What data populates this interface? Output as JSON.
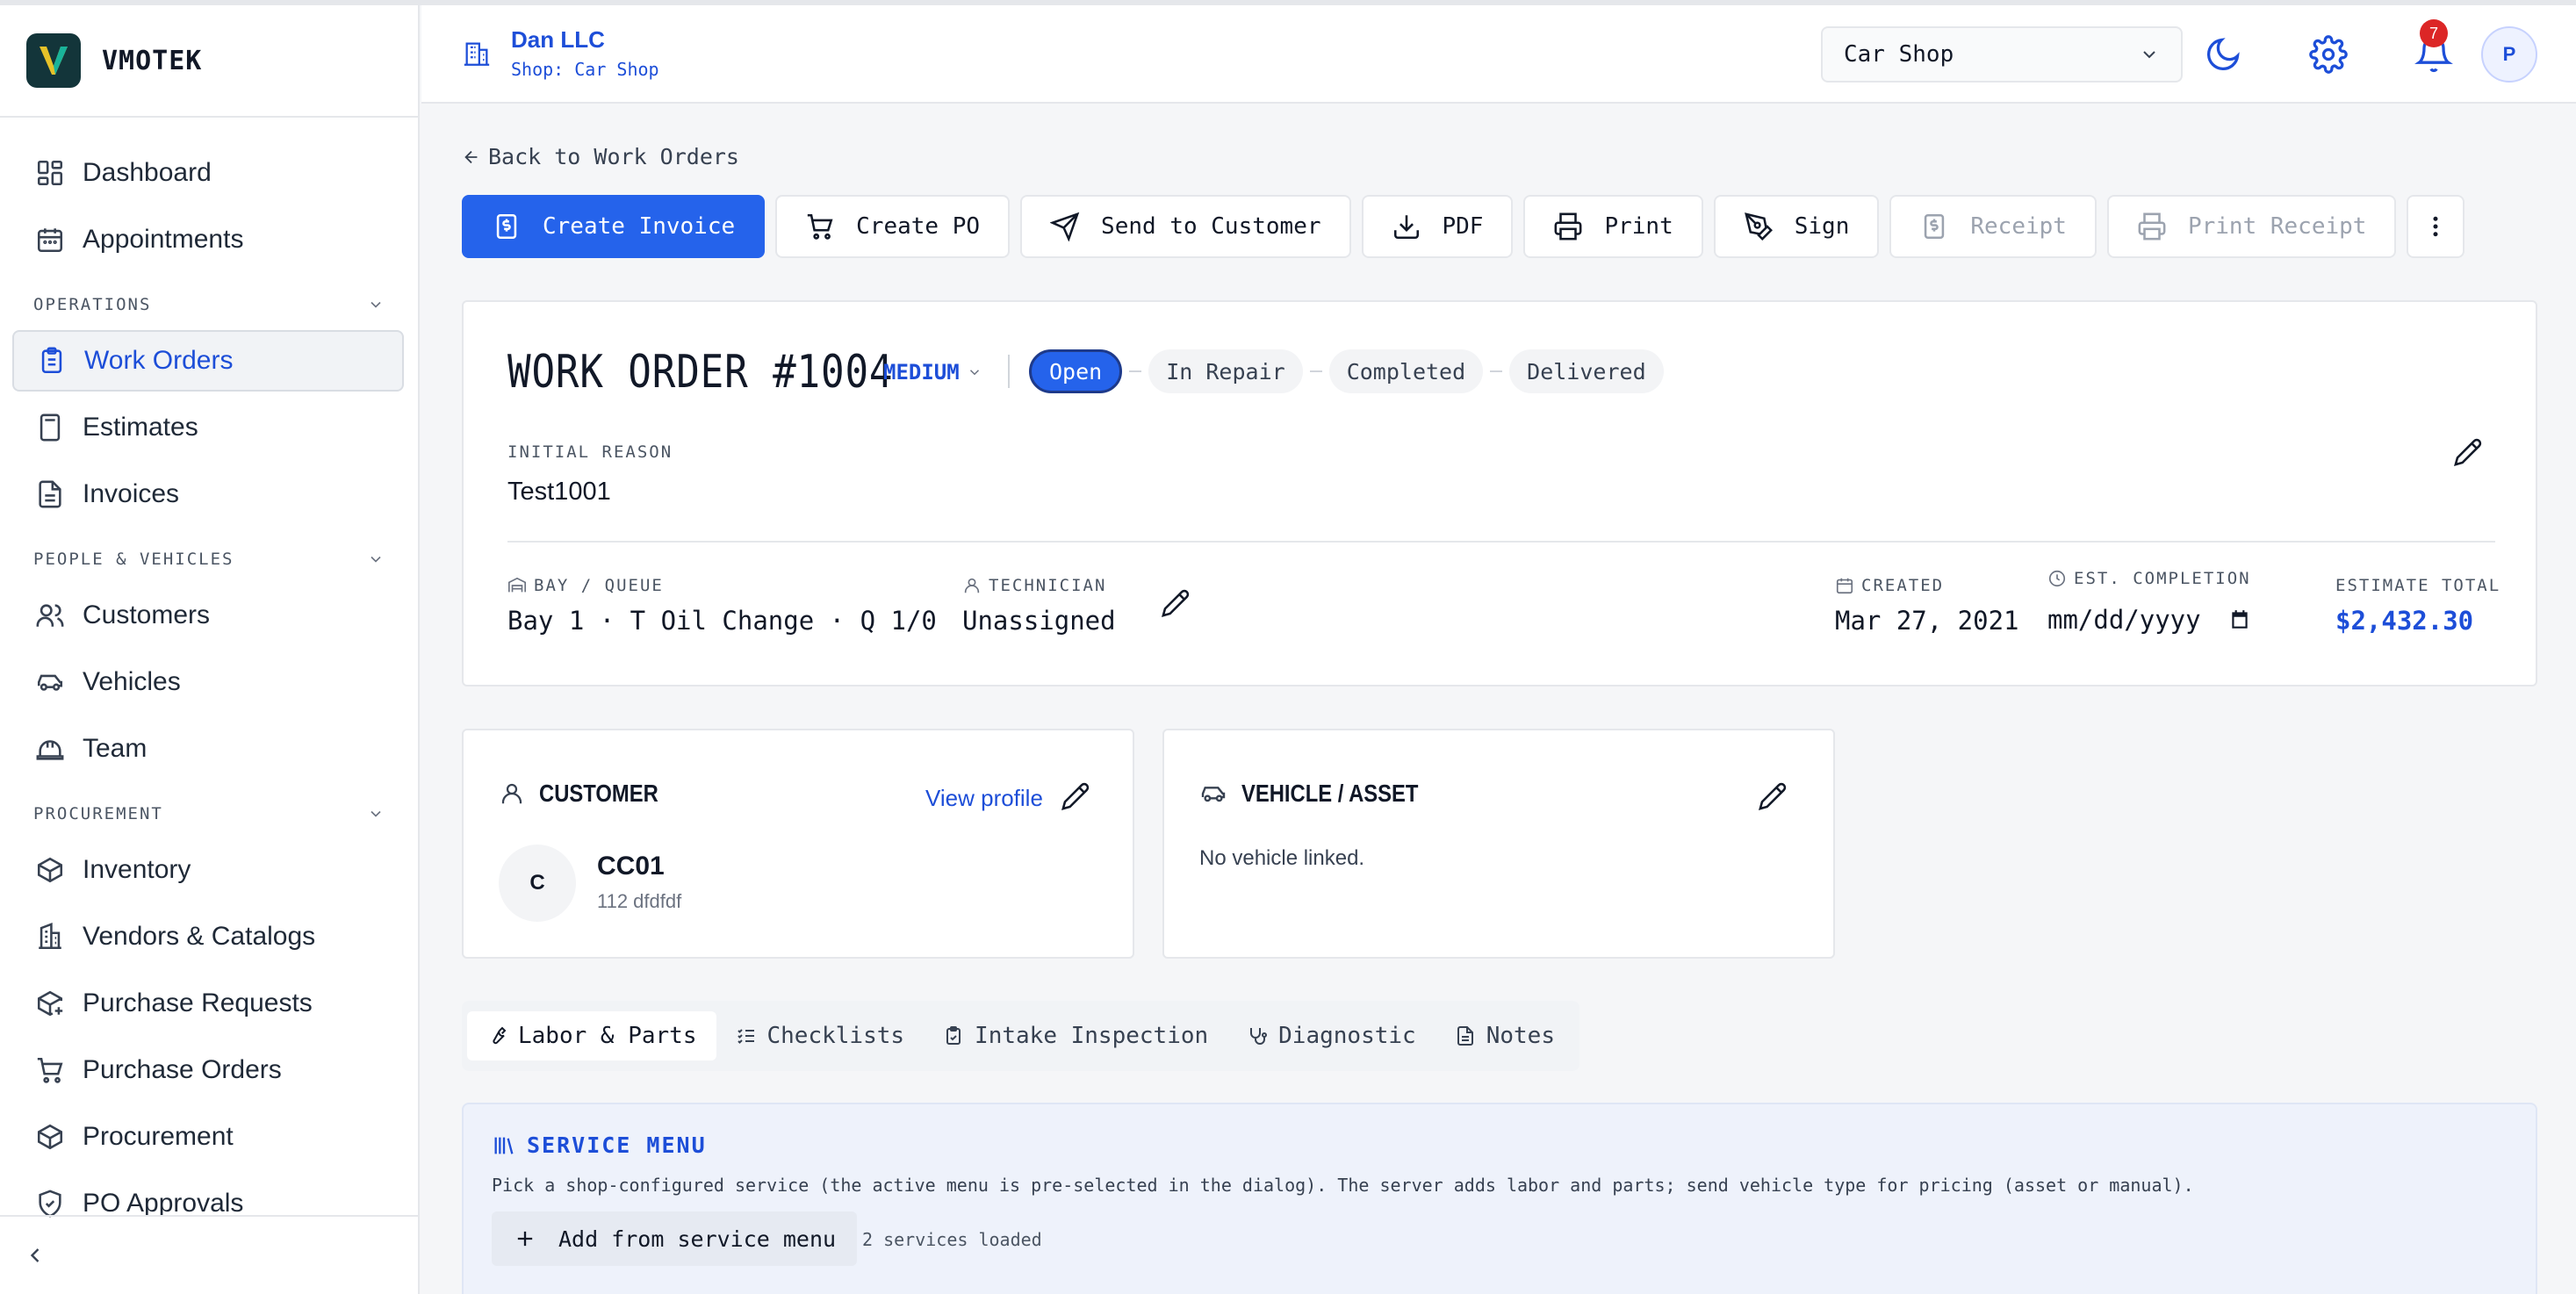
{
  "brand": {
    "name": "VMOTEK"
  },
  "sidebar": {
    "items_top": [
      {
        "label": "Dashboard"
      },
      {
        "label": "Appointments"
      }
    ],
    "sections": [
      {
        "title": "OPERATIONS",
        "items": [
          {
            "label": "Work Orders"
          },
          {
            "label": "Estimates"
          },
          {
            "label": "Invoices"
          }
        ]
      },
      {
        "title": "PEOPLE & VEHICLES",
        "items": [
          {
            "label": "Customers"
          },
          {
            "label": "Vehicles"
          },
          {
            "label": "Team"
          }
        ]
      },
      {
        "title": "PROCUREMENT",
        "items": [
          {
            "label": "Inventory"
          },
          {
            "label": "Vendors & Catalogs"
          },
          {
            "label": "Purchase Requests"
          },
          {
            "label": "Purchase Orders"
          },
          {
            "label": "Procurement"
          },
          {
            "label": "PO Approvals"
          }
        ]
      }
    ]
  },
  "header": {
    "org_name": "Dan LLC",
    "org_shop": "Shop: Car Shop",
    "shop_select": "Car Shop",
    "notifications_count": "7",
    "avatar_initial": "P"
  },
  "page": {
    "back_label": "Back to Work Orders",
    "actions": {
      "create_invoice": "Create Invoice",
      "create_po": "Create PO",
      "send_to_customer": "Send to Customer",
      "pdf": "PDF",
      "print": "Print",
      "sign": "Sign",
      "receipt": "Receipt",
      "print_receipt": "Print Receipt"
    }
  },
  "work_order": {
    "title": "WORK ORDER #1004",
    "priority": "MEDIUM",
    "statuses": [
      "Open",
      "In Repair",
      "Completed",
      "Delivered"
    ],
    "active_status": "Open",
    "initial_reason_label": "INITIAL REASON",
    "initial_reason": "Test1001",
    "bay_label": "BAY / QUEUE",
    "bay_value": "Bay 1 · T Oil Change · Q 1/0",
    "technician_label": "TECHNICIAN",
    "technician_value": "Unassigned",
    "created_label": "CREATED",
    "created_value": "Mar 27, 2021",
    "est_completion_label": "EST. COMPLETION",
    "est_completion_placeholder": "mm/dd/yyyy",
    "estimate_total_label": "ESTIMATE TOTAL",
    "estimate_total_value": "$2,432.30"
  },
  "customer": {
    "heading": "CUSTOMER",
    "view_profile": "View profile",
    "initial": "C",
    "name": "CC01",
    "address": "112 dfdfdf"
  },
  "vehicle": {
    "heading": "VEHICLE / ASSET",
    "empty": "No vehicle linked."
  },
  "tabs": [
    {
      "label": "Labor & Parts",
      "icon": "wrench-icon"
    },
    {
      "label": "Checklists",
      "icon": "checklist-icon"
    },
    {
      "label": "Intake Inspection",
      "icon": "clipboard-icon"
    },
    {
      "label": "Diagnostic",
      "icon": "stethoscope-icon"
    },
    {
      "label": "Notes",
      "icon": "note-icon"
    }
  ],
  "service_menu": {
    "title": "SERVICE MENU",
    "description": "Pick a shop-configured service (the active menu is pre-selected in the dialog). The server adds labor and parts; send vehicle type for pricing (asset or manual).",
    "add_button": "Add from service menu",
    "loaded": "2 services loaded"
  },
  "colors": {
    "accent": "#2563eb",
    "badge": "#dc2626",
    "brand_bg": "#13353a"
  }
}
